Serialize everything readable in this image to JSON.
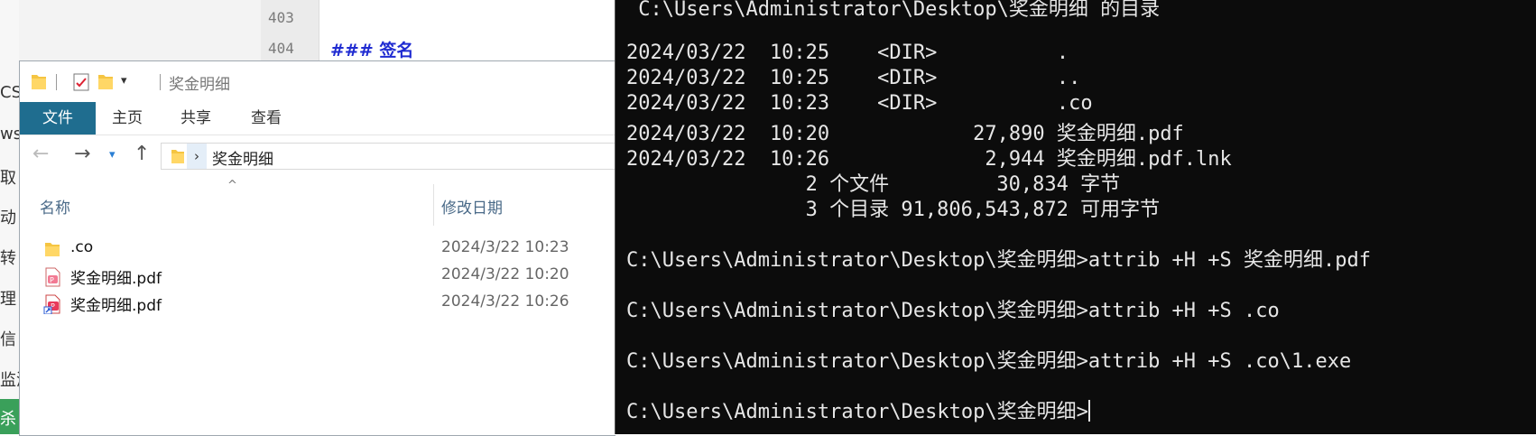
{
  "background_editor": {
    "line_numbers": [
      "403",
      "404"
    ],
    "heading": "### 签名",
    "sidebar_chars": [
      "CS",
      "ws",
      "取",
      "动",
      "转",
      "理",
      "信",
      "监测",
      "杀"
    ]
  },
  "explorer": {
    "title": "奖金明细",
    "tabs": {
      "file": "文件",
      "home": "主页",
      "share": "共享",
      "view": "查看"
    },
    "address_path": "奖金明细",
    "columns": {
      "name": "名称",
      "modified": "修改日期"
    },
    "files": [
      {
        "name": ".co",
        "date": "2024/3/22 10:23",
        "icon": "folder-icon"
      },
      {
        "name": "奖金明细.pdf",
        "date": "2024/3/22 10:20",
        "icon": "pdf-file-icon"
      },
      {
        "name": "奖金明细.pdf",
        "date": "2024/3/22 10:26",
        "icon": "pdf-shortcut-icon"
      }
    ],
    "accent_color": "#1f6d8f"
  },
  "terminal": {
    "lines": [
      " C:\\Users\\Administrator\\Desktop\\奖金明细 的目录",
      "",
      "2024/03/22  10:25    <DIR>          .",
      "2024/03/22  10:25    <DIR>          ..",
      "2024/03/22  10:23    <DIR>          .co",
      "2024/03/22  10:20            27,890 奖金明细.pdf",
      "2024/03/22  10:26             2,944 奖金明细.pdf.lnk",
      "               2 个文件         30,834 字节",
      "               3 个目录 91,806,543,872 可用字节",
      "",
      "C:\\Users\\Administrator\\Desktop\\奖金明细>attrib +H +S 奖金明细.pdf",
      "",
      "C:\\Users\\Administrator\\Desktop\\奖金明细>attrib +H +S .co",
      "",
      "C:\\Users\\Administrator\\Desktop\\奖金明细>attrib +H +S .co\\1.exe",
      "",
      "C:\\Users\\Administrator\\Desktop\\奖金明细>"
    ]
  }
}
